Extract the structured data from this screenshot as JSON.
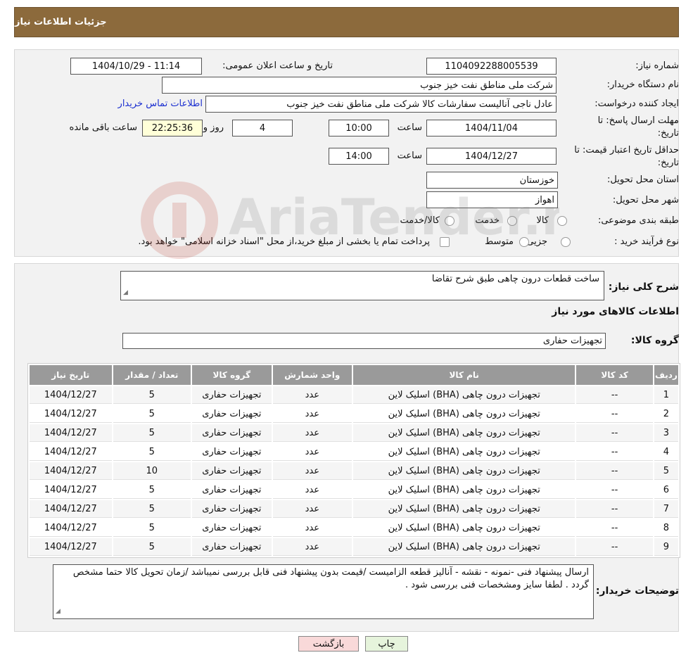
{
  "header": {
    "title": "جزئیات اطلاعات نیاز"
  },
  "form": {
    "need_number_label": "شماره نیاز:",
    "need_number": "1104092288005539",
    "announce_label": "تاریخ و ساعت اعلان عمومی:",
    "announce_value": "1404/10/29 - 11:14",
    "buyer_org_label": "نام دستگاه خریدار:",
    "buyer_org": "شرکت ملی مناطق نفت خیز جنوب",
    "creator_label": "ایجاد کننده درخواست:",
    "creator": "عادل  ناجی آنالیست سفارشات کالا  شرکت ملی مناطق نفت خیز جنوب",
    "contact_link": "اطلاعات تماس خریدار",
    "deadline_label_1": "مهلت ارسال پاسخ: تا",
    "deadline_label_2": "تاریخ:",
    "deadline_date": "1404/11/04",
    "time_label": "ساعت",
    "deadline_time": "10:00",
    "days": "4",
    "days_label": "روز و",
    "remaining": "22:25:36",
    "remaining_label": "ساعت باقی مانده",
    "validity_label_1": "حداقل تاریخ اعتبار قیمت: تا",
    "validity_label_2": "تاریخ:",
    "validity_date": "1404/12/27",
    "validity_time": "14:00",
    "province_label": "استان محل تحویل:",
    "province": "خوزستان",
    "city_label": "شهر محل تحویل:",
    "city": "اهواز",
    "category_label": "طبقه بندی موضوعی:",
    "category_options": [
      "کالا",
      "خدمت",
      "کالا/خدمت"
    ],
    "purchase_type_label": "نوع فرآیند خرید :",
    "purchase_options": [
      "جزیی",
      "متوسط"
    ],
    "payment_note": "پرداخت تمام یا بخشی از مبلغ خرید،از محل \"اسناد خزانه اسلامی\" خواهد بود."
  },
  "details": {
    "description_label": "شرح کلی نیاز:",
    "description": "ساخت قطعات درون چاهی طبق شرح تقاضا",
    "goods_info_title": "اطلاعات کالاهای مورد نیاز",
    "goods_group_label": "گروه کالا:",
    "goods_group": "تجهیزات حفاری"
  },
  "table": {
    "headers": [
      "ردیف",
      "کد کالا",
      "نام کالا",
      "واحد شمارش",
      "گروه کالا",
      "تعداد / مقدار",
      "تاریخ نیاز"
    ],
    "rows": [
      [
        "1",
        "--",
        "تجهیزات درون چاهی (BHA) اسلیک لاین",
        "عدد",
        "تجهیزات حفاری",
        "5",
        "1404/12/27"
      ],
      [
        "2",
        "--",
        "تجهیزات درون چاهی (BHA) اسلیک لاین",
        "عدد",
        "تجهیزات حفاری",
        "5",
        "1404/12/27"
      ],
      [
        "3",
        "--",
        "تجهیزات درون چاهی (BHA) اسلیک لاین",
        "عدد",
        "تجهیزات حفاری",
        "5",
        "1404/12/27"
      ],
      [
        "4",
        "--",
        "تجهیزات درون چاهی (BHA) اسلیک لاین",
        "عدد",
        "تجهیزات حفاری",
        "5",
        "1404/12/27"
      ],
      [
        "5",
        "--",
        "تجهیزات درون چاهی (BHA) اسلیک لاین",
        "عدد",
        "تجهیزات حفاری",
        "10",
        "1404/12/27"
      ],
      [
        "6",
        "--",
        "تجهیزات درون چاهی (BHA) اسلیک لاین",
        "عدد",
        "تجهیزات حفاری",
        "5",
        "1404/12/27"
      ],
      [
        "7",
        "--",
        "تجهیزات درون چاهی (BHA) اسلیک لاین",
        "عدد",
        "تجهیزات حفاری",
        "5",
        "1404/12/27"
      ],
      [
        "8",
        "--",
        "تجهیزات درون چاهی (BHA) اسلیک لاین",
        "عدد",
        "تجهیزات حفاری",
        "5",
        "1404/12/27"
      ],
      [
        "9",
        "--",
        "تجهیزات درون چاهی (BHA) اسلیک لاین",
        "عدد",
        "تجهیزات حفاری",
        "5",
        "1404/12/27"
      ]
    ]
  },
  "notes": {
    "label": "توضیحات خریدار:",
    "text": "ارسال پیشنهاد فنی  -نمونه - نقشه - آنالیز قطعه الزامیست /قیمت بدون پیشنهاد فنی قابل بررسی نمیباشد /زمان تحویل کالا حتما مشخص گردد . لطفا  سایز ومشخصات فنی بررسی شود ."
  },
  "buttons": {
    "print": "چاپ",
    "back": "بازگشت"
  },
  "watermark": "AriaTender.neT",
  "colors": {
    "header_bg": "#8c6a3c",
    "link": "#1b2fd0",
    "table_header": "#9a9a9a"
  }
}
